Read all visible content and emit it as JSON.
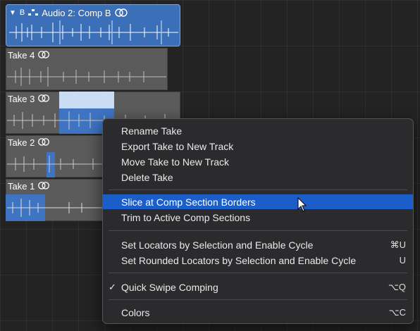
{
  "folder": {
    "collapse_icon": "▼",
    "badge": "B",
    "title": "Audio 2: Comp B"
  },
  "takes": [
    {
      "label": "Take 4"
    },
    {
      "label": "Take 3"
    },
    {
      "label": "Take 2"
    },
    {
      "label": "Take 1"
    }
  ],
  "menu": {
    "items": [
      {
        "label": "Rename Take"
      },
      {
        "label": "Export Take to New Track"
      },
      {
        "label": "Move Take to New Track"
      },
      {
        "label": "Delete Take"
      },
      {
        "label": "Slice at Comp Section Borders"
      },
      {
        "label": "Trim to Active Comp Sections"
      },
      {
        "label": "Set Locators by Selection and Enable Cycle",
        "shortcut": "⌘U"
      },
      {
        "label": "Set Rounded Locators by Selection and Enable Cycle",
        "shortcut": "U"
      },
      {
        "label": "Quick Swipe Comping",
        "shortcut": "⌥Q",
        "check": "✓"
      },
      {
        "label": "Colors",
        "shortcut": "⌥C"
      }
    ]
  },
  "colors": {
    "selection": "#3f74c2",
    "menu_highlight": "#1b5ec9",
    "folder_blue": "#3b6fb7"
  }
}
